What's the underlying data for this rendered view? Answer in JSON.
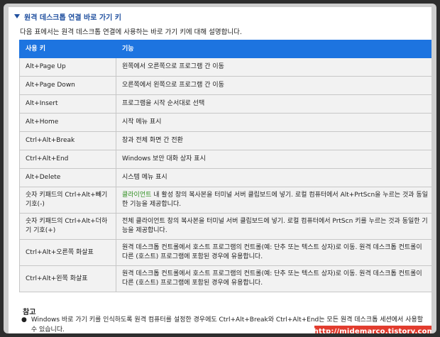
{
  "section": {
    "title": "원격 데스크톱 연결 바로 가기 키",
    "intro": "다음 표에서는 원격 데스크톱 연결에 사용하는 바로 가기 키에 대해 설명합니다."
  },
  "table": {
    "headers": [
      "사용 키",
      "기능"
    ],
    "rows": [
      {
        "key": "Alt+Page Up",
        "desc": "왼쪽에서 오른쪽으로 프로그램 간 이동"
      },
      {
        "key": "Alt+Page Down",
        "desc": "오른쪽에서 왼쪽으로 프로그램 간 이동"
      },
      {
        "key": "Alt+Insert",
        "desc": "프로그램을 시작 순서대로 선택"
      },
      {
        "key": "Alt+Home",
        "desc": "시작 메뉴 표시"
      },
      {
        "key": "Ctrl+Alt+Break",
        "desc": "창과 전체 화면 간 전환"
      },
      {
        "key": "Ctrl+Alt+End",
        "desc": "Windows 보안 대화 상자 표시"
      },
      {
        "key": "Alt+Delete",
        "desc": "시스템 메뉴 표시"
      },
      {
        "key": "숫자 키패드의 Ctrl+Alt+빼기 기호(-)",
        "desc_highlight": "클라이언트",
        "desc": " 내 활성 창의 복사본을 터미널 서버 클립보드에 넣기. 로컬 컴퓨터에서 Alt+PrtScn을 누르는 것과 동일한 기능을 제공합니다."
      },
      {
        "key": "숫자 키패드의 Ctrl+Alt+더하기 기호(+)",
        "desc": "전체 클라이언트 창의 복사본을 터미널 서버 클립보드에 넣기. 로컬 컴퓨터에서 PrtScn 키를 누르는 것과 동일한 기능을 제공합니다."
      },
      {
        "key": "Ctrl+Alt+오른쪽 화살표",
        "desc": "원격 데스크톱 컨트롤에서 호스트 프로그램의 컨트롤(예: 단추 또는 텍스트 상자)로 이동. 원격 데스크톱 컨트롤이 다른 (호스트) 프로그램에 포함된 경우에 유용합니다."
      },
      {
        "key": "Ctrl+Alt+왼쪽 화살표",
        "desc": "원격 데스크톱 컨트롤에서 호스트 프로그램의 컨트롤(예: 단추 또는 텍스트 상자)로 이동. 원격 데스크톱 컨트롤이 다른 (호스트) 프로그램에 포함된 경우에 유용합니다."
      }
    ]
  },
  "notes": {
    "title": "참고",
    "bullet": "Windows 바로 가기 키를 인식하도록 원격 컴퓨터를 설정한 경우에도 Ctrl+Alt+Break와 Ctrl+Alt+End는 모든 원격 데스크톱 세션에서 사용할 수 있습니다."
  },
  "watermark": "http://midemarco.tistory.com",
  "colors": {
    "header_bg": "#1d74e0",
    "section_title": "#1f4f9f",
    "highlight": "#2f8f1f",
    "watermark_bg": "#e23c2e"
  }
}
